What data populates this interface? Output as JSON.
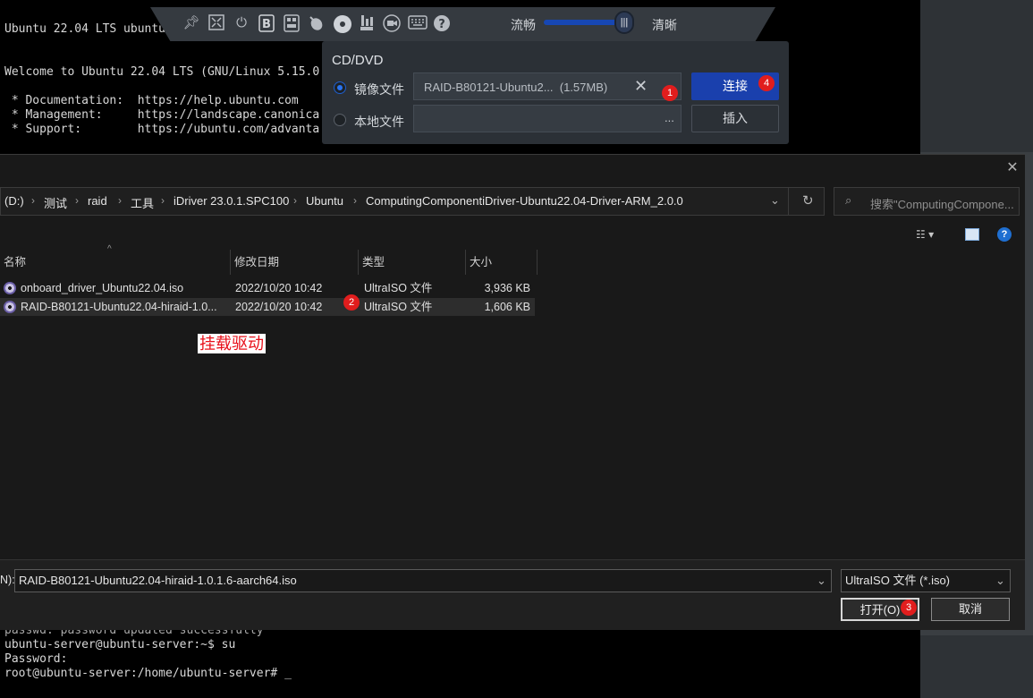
{
  "terminal": {
    "lines_top": [
      "Ubuntu 22.04 LTS ubuntu-",
      "",
      "Welcome to Ubuntu 22.04 LTS (GNU/Linux 5.15.0",
      "",
      " * Documentation:  https://help.ubuntu.com",
      " * Management:     https://landscape.canonica",
      " * Support:        https://ubuntu.com/advanta"
    ],
    "lines_bottom": [
      "passwd: password updated successfully",
      "ubuntu-server@ubuntu-server:~$ su",
      "Password:",
      "root@ubuntu-server:/home/ubuntu-server# _"
    ]
  },
  "toolbar": {
    "icons": [
      "pin-icon",
      "fullscreen-icon",
      "power-icon",
      "bold-b-icon",
      "keyboard-layout-icon",
      "mouse-icon",
      "cd-disc-icon",
      "usb-icon",
      "camera-icon",
      "keyboard-icon",
      "help-icon"
    ],
    "quality_left": "流畅",
    "quality_right": "清晰",
    "quality_level": 0.9
  },
  "cd_panel": {
    "title": "CD/DVD",
    "image_option_label": "镜像文件",
    "image_file_value": "RAID-B80121-Ubuntu2...  (1.57MB)",
    "local_option_label": "本地文件",
    "local_browse": "...",
    "connect_label": "连接",
    "insert_label": "插入"
  },
  "dialog": {
    "breadcrumbs": [
      "(D:)",
      "测试",
      "raid",
      "工具",
      "iDriver 23.0.1.SPC100",
      "Ubuntu",
      "ComputingComponentiDriver-Ubuntu22.04-Driver-ARM_2.0.0"
    ],
    "search_placeholder": "搜索\"ComputingCompone...",
    "columns": {
      "name": "名称",
      "date": "修改日期",
      "type": "类型",
      "size": "大小"
    },
    "files": [
      {
        "name": "onboard_driver_Ubuntu22.04.iso",
        "date": "2022/10/20 10:42",
        "type": "UltraISO 文件",
        "size": "3,936 KB"
      },
      {
        "name": "RAID-B80121-Ubuntu22.04-hiraid-1.0...",
        "date": "2022/10/20 10:42",
        "type": "UltraISO 文件",
        "size": "1,606 KB"
      }
    ],
    "annotation": "挂载驱动",
    "filename_label": "N):",
    "filename_value": "RAID-B80121-Ubuntu22.04-hiraid-1.0.1.6-aarch64.iso",
    "filetype_value": "UltraISO 文件 (*.iso)",
    "open_label": "打开(O)",
    "cancel_label": "取消"
  },
  "badges": [
    "1",
    "2",
    "3",
    "4"
  ]
}
